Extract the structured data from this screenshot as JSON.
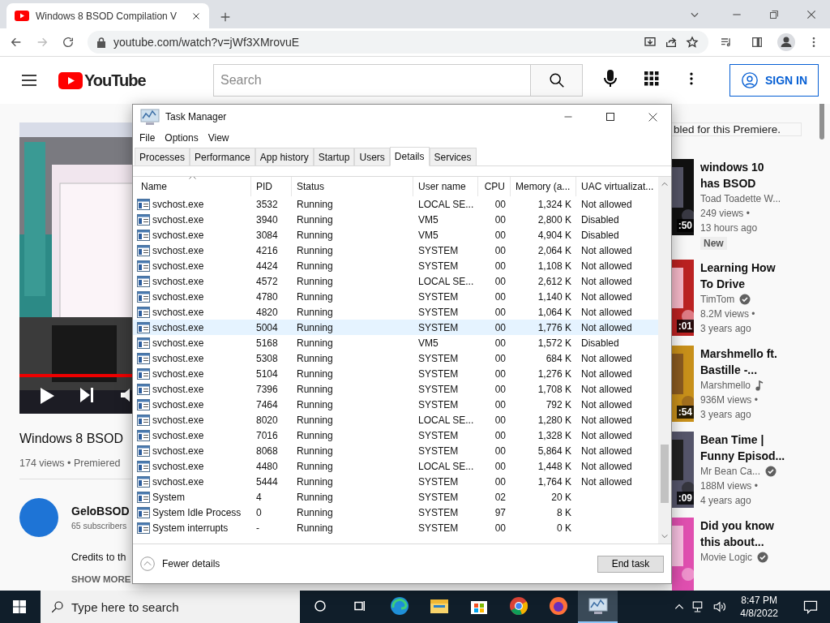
{
  "browser": {
    "tab": {
      "title": "Windows 8 BSOD Compilation V"
    },
    "url": "youtube.com/watch?v=jWf3XMrovuE"
  },
  "youtube": {
    "logo": "YouTube",
    "search": {
      "placeholder": "Search"
    },
    "sign_in": "SIGN IN"
  },
  "video": {
    "kind": "picture",
    "progress": {
      "level": 1
    },
    "title": "Windows 8 BSOD",
    "meta": "174 views • Premiered",
    "channel": "GeloBSOD",
    "subscribers": "65 subscribers",
    "description": "Credits to th",
    "show_more": "SHOW MORE"
  },
  "chat_notice": "bled for this Premiere.",
  "recommendations": [
    {
      "title": [
        "windows 10",
        "has BSOD"
      ],
      "duration": ":50",
      "channel": "Toad Toadette W...",
      "views": "249 views •",
      "age": "13 hours ago",
      "label": "New"
    },
    {
      "title": [
        "Learning How",
        "To Drive"
      ],
      "duration": ":01",
      "channel": "TimTom",
      "verified": true,
      "views": "8.2M views •",
      "age": "3 years ago"
    },
    {
      "title": [
        "Marshmello ft.",
        "Bastille -..."
      ],
      "duration": ":54",
      "channel": "Marshmello",
      "music_artist": true,
      "views": "936M views •",
      "age": "3 years ago"
    },
    {
      "title": [
        "Bean Time |",
        "Funny Episod..."
      ],
      "duration": ":09",
      "channel": "Mr Bean Ca...",
      "verified": true,
      "views": "188M views •",
      "age": "4 years ago"
    },
    {
      "title": [
        "Did you know",
        "this about..."
      ],
      "channel": "Movie Logic",
      "verified": true
    }
  ],
  "task_manager": {
    "title": "Task Manager",
    "menu": [
      "File",
      "Options",
      "View"
    ],
    "tabs": [
      {
        "label": "Processes",
        "selected": false
      },
      {
        "label": "Performance",
        "selected": false
      },
      {
        "label": "App history",
        "selected": false
      },
      {
        "label": "Startup",
        "selected": false
      },
      {
        "label": "Users",
        "selected": false
      },
      {
        "label": "Details",
        "selected": true
      },
      {
        "label": "Services",
        "selected": false
      }
    ],
    "columns": [
      "Name",
      "PID",
      "Status",
      "User name",
      "CPU",
      "Memory (a...",
      "UAC virtualizat..."
    ],
    "rows": [
      {
        "cells": [
          "svchost.exe",
          "3532",
          "Running",
          "LOCAL SE...",
          "00",
          "1,324 K",
          "Not allowed"
        ],
        "selected": false
      },
      {
        "cells": [
          "svchost.exe",
          "3940",
          "Running",
          "VM5",
          "00",
          "2,800 K",
          "Disabled"
        ],
        "selected": false
      },
      {
        "cells": [
          "svchost.exe",
          "3084",
          "Running",
          "VM5",
          "00",
          "4,904 K",
          "Disabled"
        ],
        "selected": false
      },
      {
        "cells": [
          "svchost.exe",
          "4216",
          "Running",
          "SYSTEM",
          "00",
          "2,064 K",
          "Not allowed"
        ],
        "selected": false
      },
      {
        "cells": [
          "svchost.exe",
          "4424",
          "Running",
          "SYSTEM",
          "00",
          "1,108 K",
          "Not allowed"
        ],
        "selected": false
      },
      {
        "cells": [
          "svchost.exe",
          "4572",
          "Running",
          "LOCAL SE...",
          "00",
          "2,612 K",
          "Not allowed"
        ],
        "selected": false
      },
      {
        "cells": [
          "svchost.exe",
          "4780",
          "Running",
          "SYSTEM",
          "00",
          "1,140 K",
          "Not allowed"
        ],
        "selected": false
      },
      {
        "cells": [
          "svchost.exe",
          "4820",
          "Running",
          "SYSTEM",
          "00",
          "1,064 K",
          "Not allowed"
        ],
        "selected": false
      },
      {
        "cells": [
          "svchost.exe",
          "5004",
          "Running",
          "SYSTEM",
          "00",
          "1,776 K",
          "Not allowed"
        ],
        "selected": true
      },
      {
        "cells": [
          "svchost.exe",
          "5168",
          "Running",
          "VM5",
          "00",
          "1,572 K",
          "Disabled"
        ],
        "selected": false
      },
      {
        "cells": [
          "svchost.exe",
          "5308",
          "Running",
          "SYSTEM",
          "00",
          "684 K",
          "Not allowed"
        ],
        "selected": false
      },
      {
        "cells": [
          "svchost.exe",
          "5104",
          "Running",
          "SYSTEM",
          "00",
          "1,276 K",
          "Not allowed"
        ],
        "selected": false
      },
      {
        "cells": [
          "svchost.exe",
          "7396",
          "Running",
          "SYSTEM",
          "00",
          "1,708 K",
          "Not allowed"
        ],
        "selected": false
      },
      {
        "cells": [
          "svchost.exe",
          "7464",
          "Running",
          "SYSTEM",
          "00",
          "792 K",
          "Not allowed"
        ],
        "selected": false
      },
      {
        "cells": [
          "svchost.exe",
          "8020",
          "Running",
          "LOCAL SE...",
          "00",
          "1,280 K",
          "Not allowed"
        ],
        "selected": false
      },
      {
        "cells": [
          "svchost.exe",
          "7016",
          "Running",
          "SYSTEM",
          "00",
          "1,328 K",
          "Not allowed"
        ],
        "selected": false
      },
      {
        "cells": [
          "svchost.exe",
          "8068",
          "Running",
          "SYSTEM",
          "00",
          "5,864 K",
          "Not allowed"
        ],
        "selected": false
      },
      {
        "cells": [
          "svchost.exe",
          "4480",
          "Running",
          "LOCAL SE...",
          "00",
          "1,448 K",
          "Not allowed"
        ],
        "selected": false
      },
      {
        "cells": [
          "svchost.exe",
          "5444",
          "Running",
          "SYSTEM",
          "00",
          "1,764 K",
          "Not allowed"
        ],
        "selected": false
      },
      {
        "cells": [
          "System",
          "4",
          "Running",
          "SYSTEM",
          "02",
          "20 K"
        ],
        "selected": false
      },
      {
        "cells": [
          "System Idle Process",
          "0",
          "Running",
          "SYSTEM",
          "97",
          "8 K"
        ],
        "selected": false
      },
      {
        "cells": [
          "System interrupts",
          "-",
          "Running",
          "SYSTEM",
          "00",
          "0 K"
        ],
        "selected": false
      }
    ],
    "fewer_details": "Fewer details",
    "end_task": "End task"
  },
  "taskbar": {
    "search": {
      "placeholder": "Type here to search"
    },
    "apps": [
      {
        "kind": "cortana",
        "active": false
      },
      {
        "kind": "taskview",
        "active": false
      },
      {
        "kind": "edge",
        "active": false
      },
      {
        "kind": "explorer",
        "active": false
      },
      {
        "kind": "store",
        "active": false
      },
      {
        "kind": "chrome",
        "active": false
      },
      {
        "kind": "firefox",
        "active": false
      },
      {
        "kind": "taskmgr",
        "active": true
      }
    ],
    "time": "8:47 PM",
    "date": "4/8/2022"
  }
}
